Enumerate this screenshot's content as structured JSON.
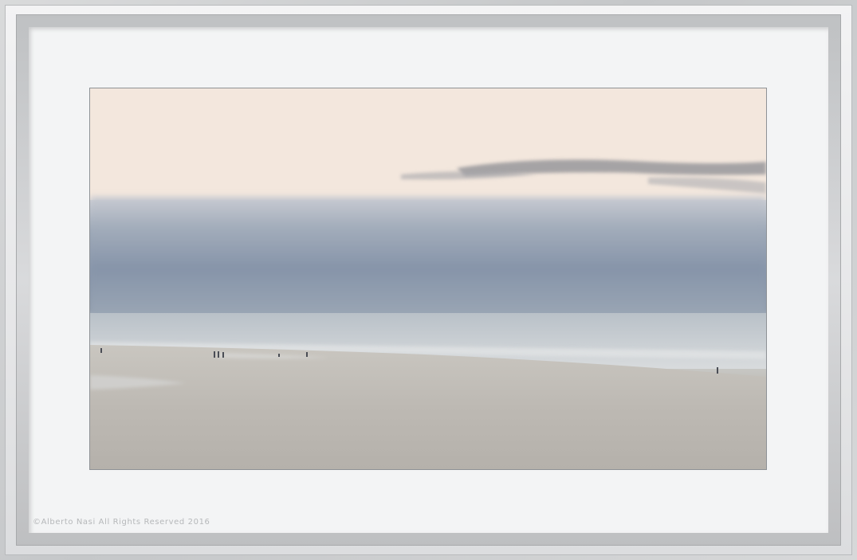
{
  "watermark": {
    "text": "©Alberto Nasi All Rights Reserved 2016"
  },
  "scene": {
    "subject": "misty-beach-at-dusk",
    "colors": {
      "sky_top": "#f4e9df",
      "cloud_band": "#8896ab",
      "sea": "#d5d9dc",
      "sand": "#b7b3ad",
      "frame": "#c5c7c9",
      "mat": "#f3f4f5"
    }
  }
}
